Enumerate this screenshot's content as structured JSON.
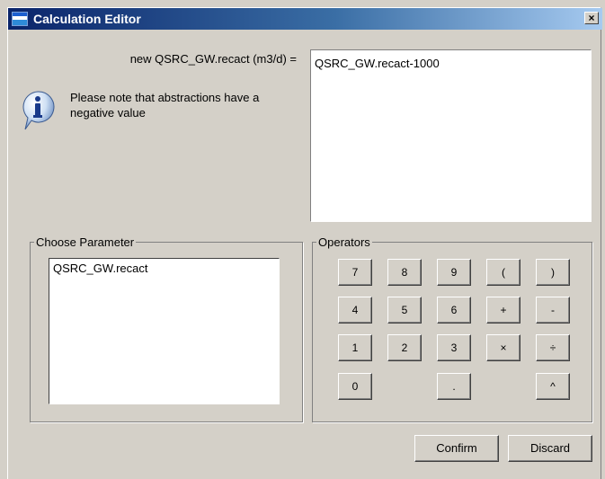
{
  "window": {
    "title": "Calculation Editor",
    "close_label": "×"
  },
  "formula": {
    "label": "new QSRC_GW.recact (m3/d) =",
    "value": "QSRC_GW.recact-1000"
  },
  "note": {
    "text": "Please note that abstractions have a negative value"
  },
  "parameters": {
    "legend": "Choose Parameter",
    "items": [
      "QSRC_GW.recact"
    ]
  },
  "operators": {
    "legend": "Operators",
    "keys": [
      "7",
      "8",
      "9",
      "(",
      ")",
      "4",
      "5",
      "6",
      "+",
      "-",
      "1",
      "2",
      "3",
      "×",
      "÷",
      "0",
      ".",
      "^"
    ]
  },
  "buttons": {
    "confirm": "Confirm",
    "discard": "Discard"
  }
}
